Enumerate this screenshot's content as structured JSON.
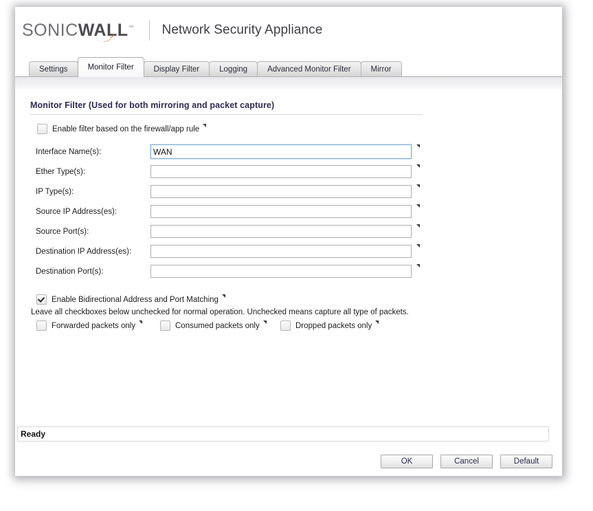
{
  "header": {
    "logo_primary": "SONIC",
    "logo_bold": "WALL",
    "logo_tm": "™",
    "logo_icon": "sonicwall-swoosh-icon",
    "appliance_title": "Network Security Appliance",
    "accent_color": "#e8721f",
    "logo_color": "#6e6e73"
  },
  "tabs": [
    {
      "label": "Settings",
      "active": false
    },
    {
      "label": "Monitor Filter",
      "active": true
    },
    {
      "label": "Display Filter",
      "active": false
    },
    {
      "label": "Logging",
      "active": false
    },
    {
      "label": "Advanced Monitor Filter",
      "active": false
    },
    {
      "label": "Mirror",
      "active": false
    }
  ],
  "panel": {
    "section_title": "Monitor Filter (Used for both mirroring and packet capture)",
    "section_title_color": "#2b2b55",
    "enable_firewall_rule_filter": {
      "label": "Enable filter based on the firewall/app rule",
      "checked": false
    },
    "fields": [
      {
        "label": "Interface Name(s):",
        "value": "WAN",
        "placeholder": "",
        "focused": true
      },
      {
        "label": "Ether Type(s):",
        "value": "",
        "placeholder": "",
        "focused": false
      },
      {
        "label": "IP Type(s):",
        "value": "",
        "placeholder": "",
        "focused": false
      },
      {
        "label": "Source IP Address(es):",
        "value": "",
        "placeholder": "",
        "focused": false
      },
      {
        "label": "Source Port(s):",
        "value": "",
        "placeholder": "",
        "focused": false
      },
      {
        "label": "Destination IP Address(es):",
        "value": "",
        "placeholder": "",
        "focused": false
      },
      {
        "label": "Destination Port(s):",
        "value": "",
        "placeholder": "",
        "focused": false
      }
    ],
    "bidirectional": {
      "label": "Enable Bidirectional Address and Port Matching",
      "checked": true
    },
    "note": "Leave all checkboxes below unchecked for normal operation. Unchecked means capture all type of packets.",
    "packet_options": [
      {
        "label": "Forwarded packets only",
        "checked": false
      },
      {
        "label": "Consumed packets only",
        "checked": false
      },
      {
        "label": "Dropped packets only",
        "checked": false
      }
    ]
  },
  "status": {
    "text": "Ready"
  },
  "footer": {
    "buttons": [
      {
        "label": "OK"
      },
      {
        "label": "Cancel"
      },
      {
        "label": "Default"
      }
    ]
  }
}
